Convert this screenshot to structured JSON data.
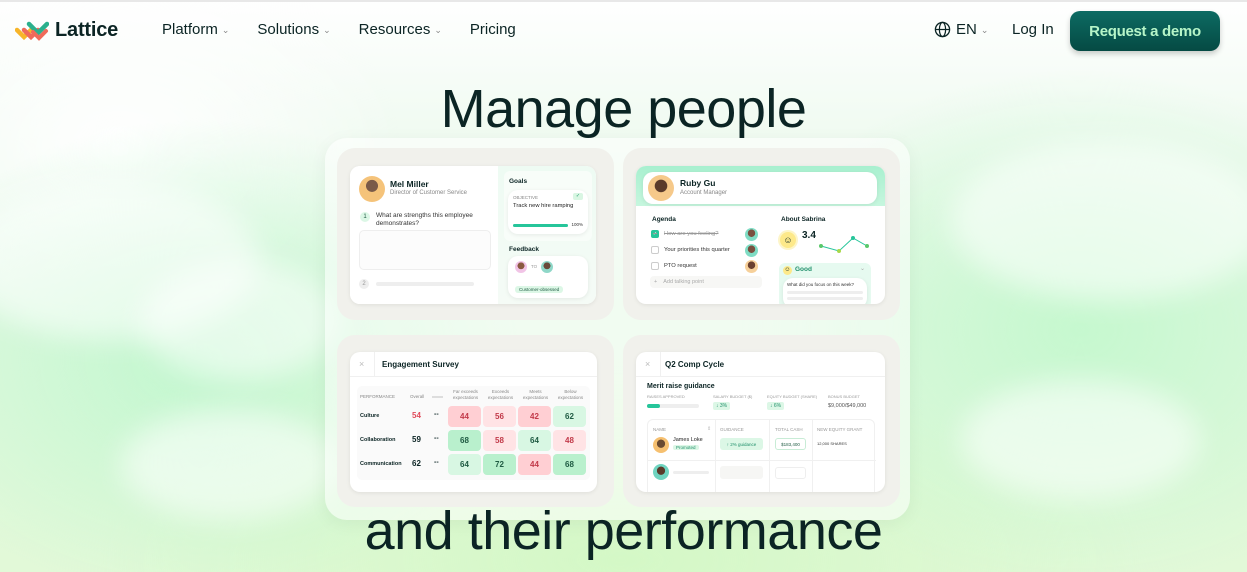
{
  "nav": {
    "brand": "Lattice",
    "links": [
      {
        "label": "Platform",
        "has_dropdown": true
      },
      {
        "label": "Solutions",
        "has_dropdown": true
      },
      {
        "label": "Resources",
        "has_dropdown": true
      },
      {
        "label": "Pricing",
        "has_dropdown": false
      }
    ],
    "language": "EN",
    "login": "Log In",
    "cta": "Request a demo",
    "cta_color": "#0a5c55",
    "cta_text_color": "#b6f5c8"
  },
  "hero": {
    "headline_top": "Manage people",
    "headline_bottom": "and their performance"
  },
  "review_card": {
    "name": "Mel Miller",
    "title": "Director of Customer Service",
    "question_number": "1",
    "question": "What are strengths this employee demonstrates?",
    "question2_number": "2",
    "goals_heading": "Goals",
    "objective_label": "OBJECTIVE",
    "goal": "Track new hire ramping",
    "goal_progress": "100%",
    "feedback_heading": "Feedback",
    "feedback_to": "TO",
    "feedback_tag": "Customer-obsessed"
  },
  "one_on_one_card": {
    "name": "Ruby Gu",
    "title": "Account Manager",
    "agenda_heading": "Agenda",
    "agenda": [
      {
        "label": "How are you feeling?",
        "checked": true
      },
      {
        "label": "Your priorities this quarter",
        "checked": false
      },
      {
        "label": "PTO request",
        "checked": false
      }
    ],
    "add_point": "Add talking point",
    "about_heading": "About Sabrina",
    "score": "3.4",
    "sentiment": "Good",
    "prompt": "What did you focus on this week?"
  },
  "survey_card": {
    "title": "Engagement Survey",
    "columns": [
      "PERFORMANCE",
      "Overall",
      "",
      "Far exceeds expectations",
      "Exceeds expectations",
      "Meets expectations",
      "Below expectations"
    ],
    "rows": [
      {
        "label": "Culture",
        "overall": "54",
        "dash": "--",
        "values": [
          "44",
          "56",
          "42",
          "62"
        ]
      },
      {
        "label": "Collaboration",
        "overall": "59",
        "dash": "--",
        "values": [
          "68",
          "58",
          "64",
          "48"
        ]
      },
      {
        "label": "Communication",
        "overall": "62",
        "dash": "--",
        "values": [
          "64",
          "72",
          "44",
          "68"
        ]
      }
    ]
  },
  "comp_card": {
    "title": "Q2 Comp Cycle",
    "section": "Merit raise guidance",
    "stats": [
      {
        "label": "RAISES APPROVED",
        "value": ""
      },
      {
        "label": "SALARY BUDGET ($)",
        "value": "↓ 3%"
      },
      {
        "label": "EQUITY BUDGET (SHARE)",
        "value": "↓ 6%"
      },
      {
        "label": "BONUS BUDGET",
        "value": "$9,000/$49,000"
      }
    ],
    "columns": [
      "NAME",
      "GUIDANCE",
      "TOTAL CASH",
      "NEW EQUITY GRANT"
    ],
    "rows": [
      {
        "name": "James Loke",
        "badge": "Promoted",
        "guidance": "↑ 2% guidance",
        "cash": "$183,400",
        "equity": "12,000 SHARES"
      }
    ]
  }
}
